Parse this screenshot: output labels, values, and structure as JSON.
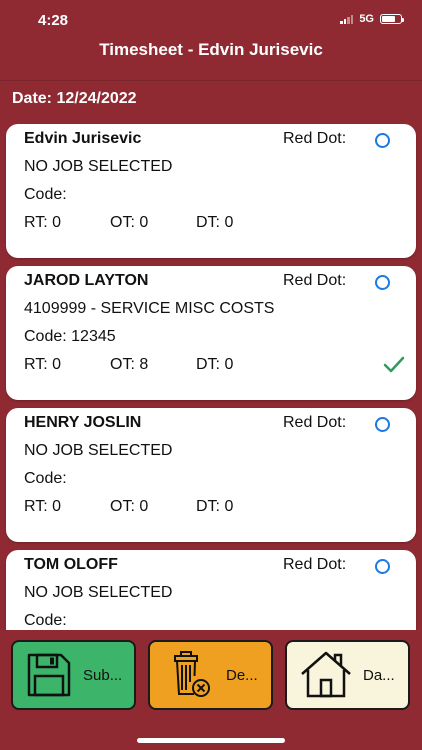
{
  "status": {
    "time": "4:28",
    "network": "5G"
  },
  "header": {
    "title": "Timesheet - Edvin Jurisevic"
  },
  "date_label": "Date: 12/24/2022",
  "red_dot_label": "Red Dot:",
  "cards": [
    {
      "name": "Edvin Jurisevic",
      "job": "NO JOB SELECTED",
      "code": "Code:",
      "rt": "RT: 0",
      "ot": "OT: 0",
      "dt": "DT: 0",
      "checked": false
    },
    {
      "name": "JAROD LAYTON",
      "job": "4109999 - SERVICE MISC  COSTS",
      "code": "Code: 12345",
      "rt": "RT: 0",
      "ot": "OT: 8",
      "dt": "DT: 0",
      "checked": true
    },
    {
      "name": "HENRY JOSLIN",
      "job": "NO JOB SELECTED",
      "code": "Code:",
      "rt": "RT: 0",
      "ot": "OT: 0",
      "dt": "DT: 0",
      "checked": false
    },
    {
      "name": "TOM OLOFF",
      "job": "NO JOB SELECTED",
      "code": "Code:",
      "rt": "",
      "ot": "",
      "dt": "",
      "checked": false
    }
  ],
  "buttons": {
    "submit": "Sub...",
    "delete": "De...",
    "dashboard": "Da..."
  },
  "colors": {
    "background": "#8f2a33",
    "radio": "#1c79e0",
    "check": "#2e9b5a",
    "submit": "#3cb56a",
    "delete": "#f0a021",
    "dashboard": "#f8f5dc"
  }
}
